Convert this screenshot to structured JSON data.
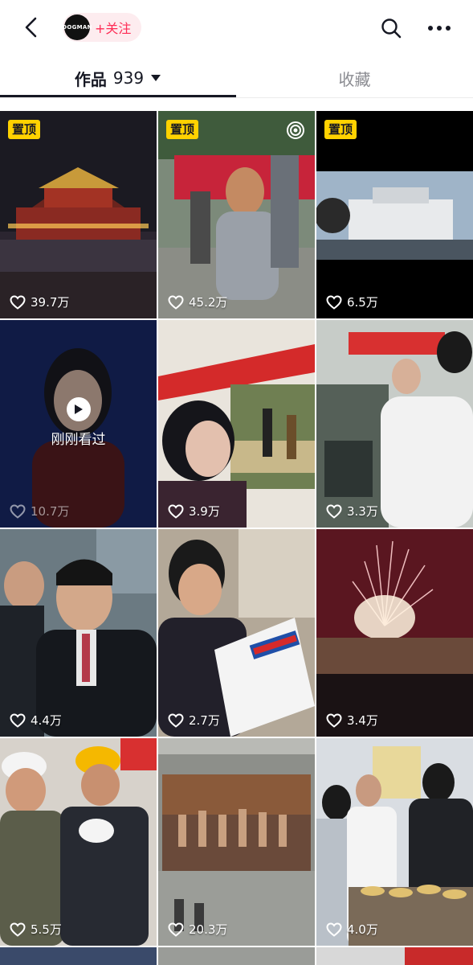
{
  "header": {
    "avatar_text": "DOGMAN",
    "follow_label": "+关注",
    "icons": [
      "back-icon",
      "search-icon",
      "more-icon"
    ]
  },
  "tabs": {
    "works_label": "作品",
    "works_count": "939",
    "favorites_label": "收藏"
  },
  "videos": [
    {
      "pinned": true,
      "pin_label": "置顶",
      "likes": "39.7万"
    },
    {
      "pinned": true,
      "pin_label": "置顶",
      "likes": "45.2万",
      "live_icon": true
    },
    {
      "pinned": true,
      "pin_label": "置顶",
      "likes": "6.5万"
    },
    {
      "likes": "10.7万",
      "watched": true,
      "watched_label": "刚刚看过"
    },
    {
      "likes": "3.9万"
    },
    {
      "likes": "3.3万"
    },
    {
      "likes": "4.4万"
    },
    {
      "likes": "2.7万"
    },
    {
      "likes": "3.4万"
    },
    {
      "likes": "5.5万"
    },
    {
      "likes": "20.3万"
    },
    {
      "likes": "4.0万"
    }
  ],
  "colors": {
    "accent": "#fe2c55",
    "pin": "#ffd200",
    "text": "#161823",
    "muted": "#8a8b91"
  }
}
